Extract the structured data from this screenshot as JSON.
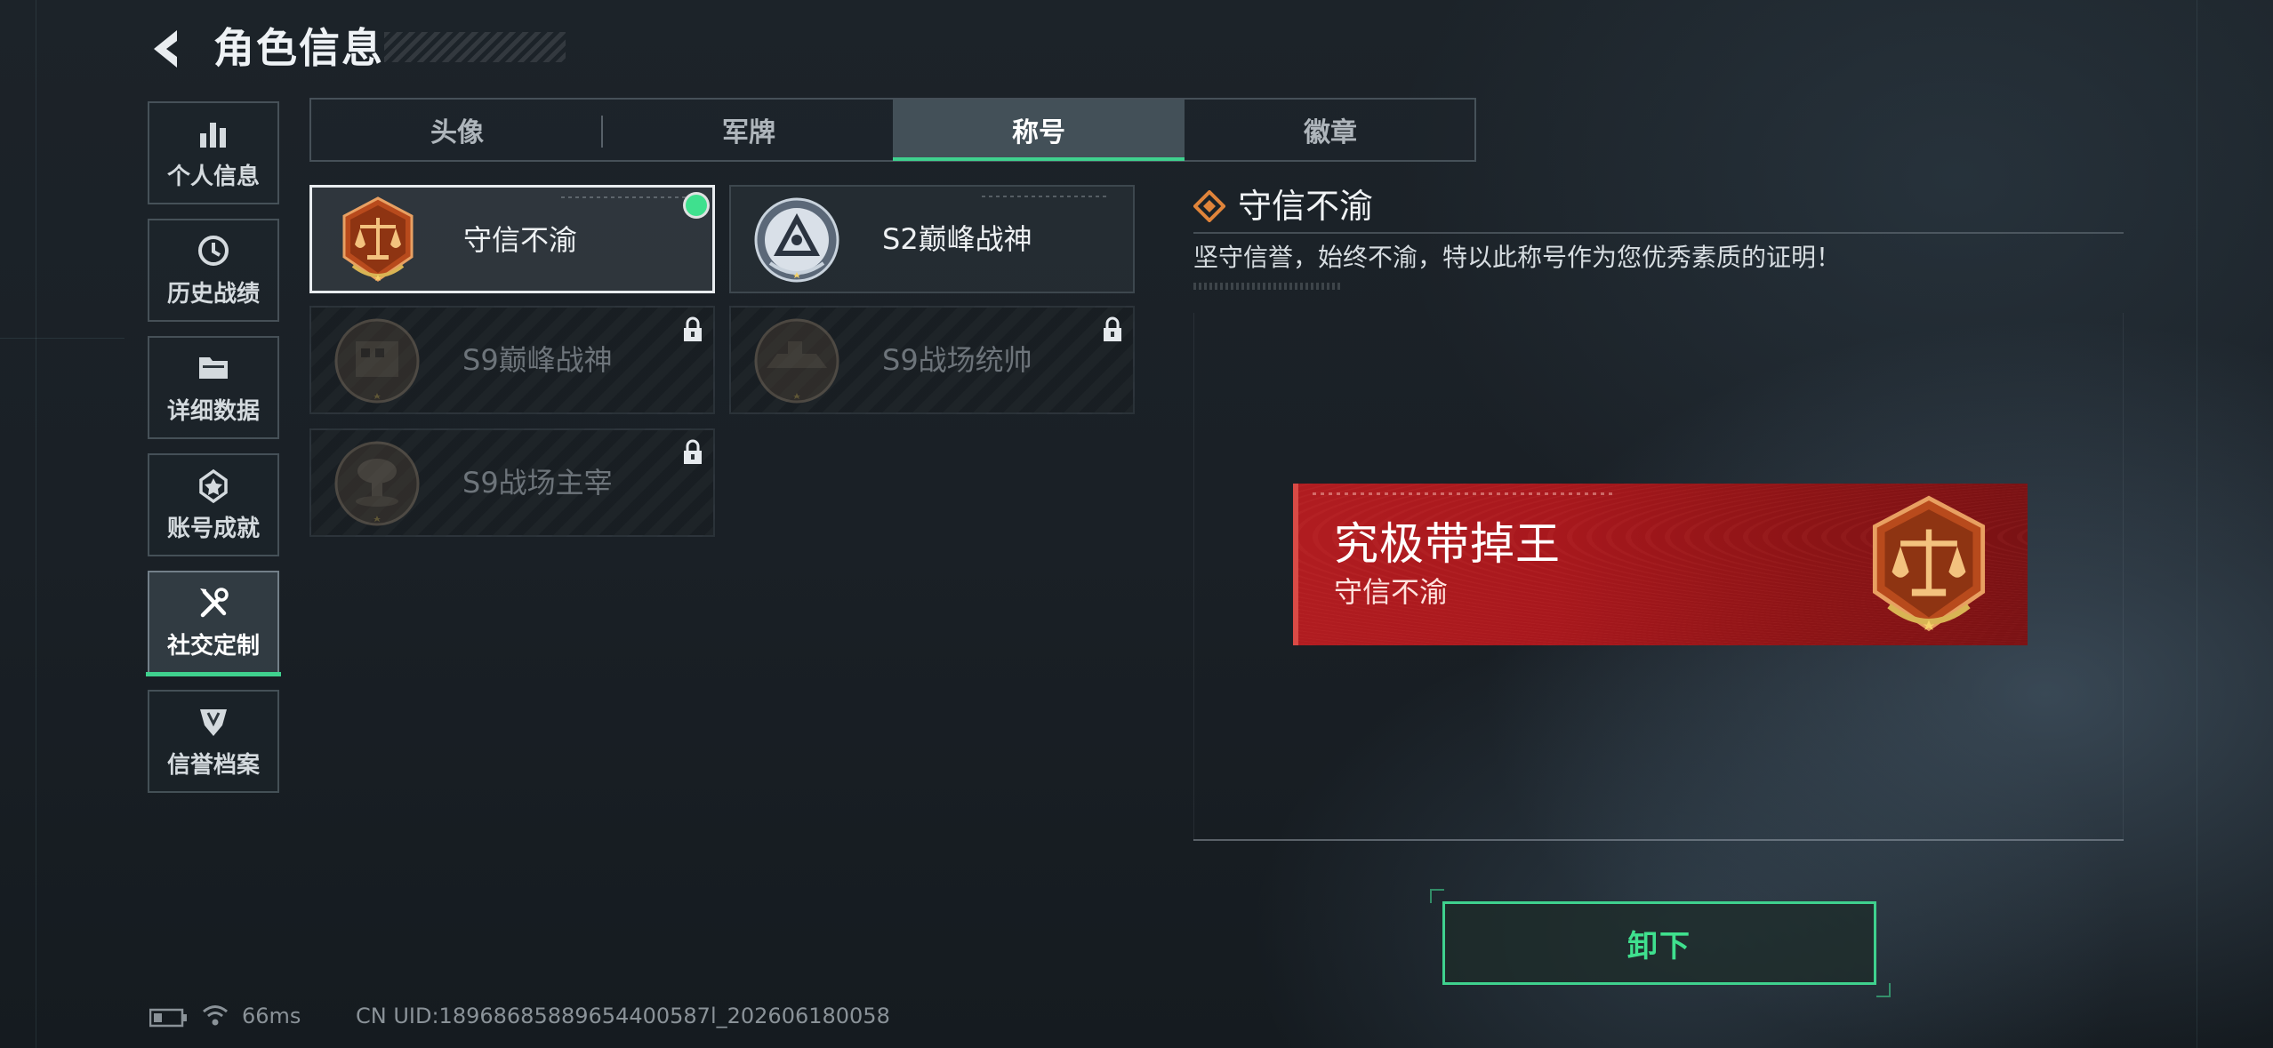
{
  "header": {
    "title": "角色信息"
  },
  "sidebar": {
    "items": [
      {
        "label": "个人信息",
        "icon": "bar-chart-icon",
        "active": false
      },
      {
        "label": "历史战绩",
        "icon": "history-clock-icon",
        "active": false
      },
      {
        "label": "详细数据",
        "icon": "folder-icon",
        "active": false
      },
      {
        "label": "账号成就",
        "icon": "achievement-icon",
        "active": false
      },
      {
        "label": "社交定制",
        "icon": "tools-icon",
        "active": true
      },
      {
        "label": "信誉档案",
        "icon": "credit-shield-icon",
        "active": false
      }
    ]
  },
  "tabs": [
    {
      "label": "头像",
      "active": false
    },
    {
      "label": "军牌",
      "active": false
    },
    {
      "label": "称号",
      "active": true
    },
    {
      "label": "徽章",
      "active": false
    }
  ],
  "titles": [
    {
      "name": "守信不渝",
      "icon": "scales-emblem-icon",
      "selected": true,
      "equipped": true,
      "locked": false
    },
    {
      "name": "S2巅峰战神",
      "icon": "s2-peak-emblem-icon",
      "selected": false,
      "equipped": false,
      "locked": false
    },
    {
      "name": "S9巅峰战神",
      "icon": "s9-peak-emblem-icon",
      "selected": false,
      "equipped": false,
      "locked": true
    },
    {
      "name": "S9战场统帅",
      "icon": "s9-commander-emblem-icon",
      "selected": false,
      "equipped": false,
      "locked": true
    },
    {
      "name": "S9战场主宰",
      "icon": "s9-dominator-emblem-icon",
      "selected": false,
      "equipped": false,
      "locked": true
    }
  ],
  "detail": {
    "title": "守信不渝",
    "description": "坚守信誉，始终不渝，特以此称号作为您优秀素质的证明！",
    "banner": {
      "player_name": "究极带掉王",
      "title": "守信不渝",
      "background_color": "#a8181d"
    },
    "action_label": "卸下"
  },
  "status": {
    "ping": "66ms",
    "uid": "CN UID:18968685889654400587l_202606180058"
  },
  "colors": {
    "accent": "#3fd18e",
    "banner_red": "#a8181d",
    "emblem_orange": "#c2501e"
  }
}
